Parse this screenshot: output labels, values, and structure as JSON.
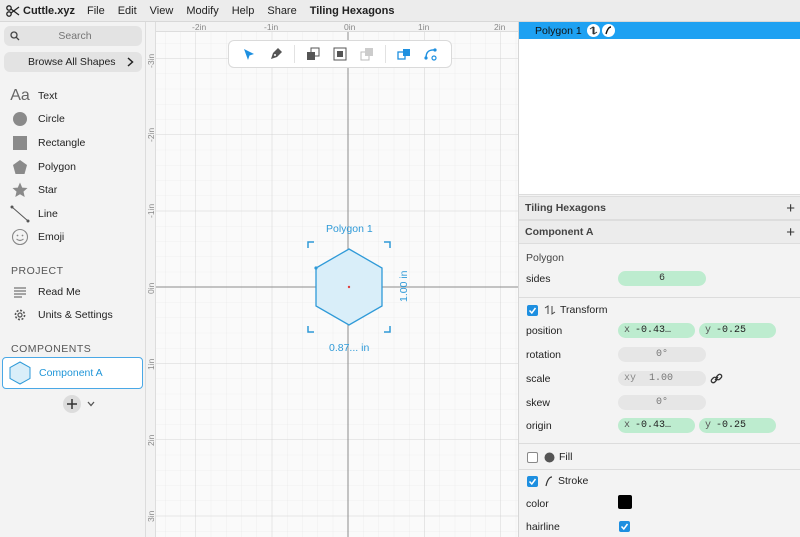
{
  "menubar": {
    "app_name": "Cuttle.xyz",
    "items": [
      "File",
      "Edit",
      "View",
      "Modify",
      "Help",
      "Share"
    ],
    "document_title": "Tiling Hexagons"
  },
  "sidebar": {
    "search_placeholder": "Search",
    "browse_label": "Browse All Shapes",
    "shapes": [
      {
        "label": "Text",
        "icon": "text-icon"
      },
      {
        "label": "Circle",
        "icon": "circle-icon"
      },
      {
        "label": "Rectangle",
        "icon": "rectangle-icon"
      },
      {
        "label": "Polygon",
        "icon": "polygon-icon"
      },
      {
        "label": "Star",
        "icon": "star-icon"
      },
      {
        "label": "Line",
        "icon": "line-icon"
      },
      {
        "label": "Emoji",
        "icon": "emoji-icon"
      }
    ],
    "project_title": "PROJECT",
    "project_items": [
      {
        "label": "Read Me",
        "icon": "read-me-icon"
      },
      {
        "label": "Units & Settings",
        "icon": "gear-icon"
      }
    ],
    "components_title": "COMPONENTS",
    "component": {
      "label": "Component A",
      "icon": "hexagon-icon"
    }
  },
  "canvas": {
    "ruler_top": [
      "-2in",
      "-1in",
      "0in",
      "1in",
      "2in"
    ],
    "ruler_left": [
      "-3in",
      "-2in",
      "-1in",
      "0in",
      "1in",
      "2in",
      "3in"
    ],
    "shape_label": "Polygon 1",
    "width_label": "0.87... in",
    "height_label": "1.00 in"
  },
  "right_panel": {
    "selected_layer": "Polygon 1",
    "sections": {
      "document": "Tiling Hexagons",
      "component": "Component A"
    },
    "polygon": {
      "title": "Polygon",
      "sides_label": "sides",
      "sides_value": "6"
    },
    "transform": {
      "title": "Transform",
      "position_label": "position",
      "position_x_key": "x",
      "position_x": "-0.43…",
      "position_y_key": "y",
      "position_y": "-0.25",
      "rotation_label": "rotation",
      "rotation": "0°",
      "scale_label": "scale",
      "scale_key": "xy",
      "scale": "1.00",
      "skew_label": "skew",
      "skew": "0°",
      "origin_label": "origin",
      "origin_x_key": "x",
      "origin_x": "-0.43…",
      "origin_y_key": "y",
      "origin_y": "-0.25"
    },
    "fill": {
      "title": "Fill"
    },
    "stroke": {
      "title": "Stroke",
      "color_label": "color",
      "color": "#000000",
      "hairline_label": "hairline"
    }
  },
  "colors": {
    "accent": "#1ea1f2",
    "shape_stroke": "#2f9ad8",
    "shape_fill": "#d9eef9",
    "value_pill": "#bdeccf"
  }
}
